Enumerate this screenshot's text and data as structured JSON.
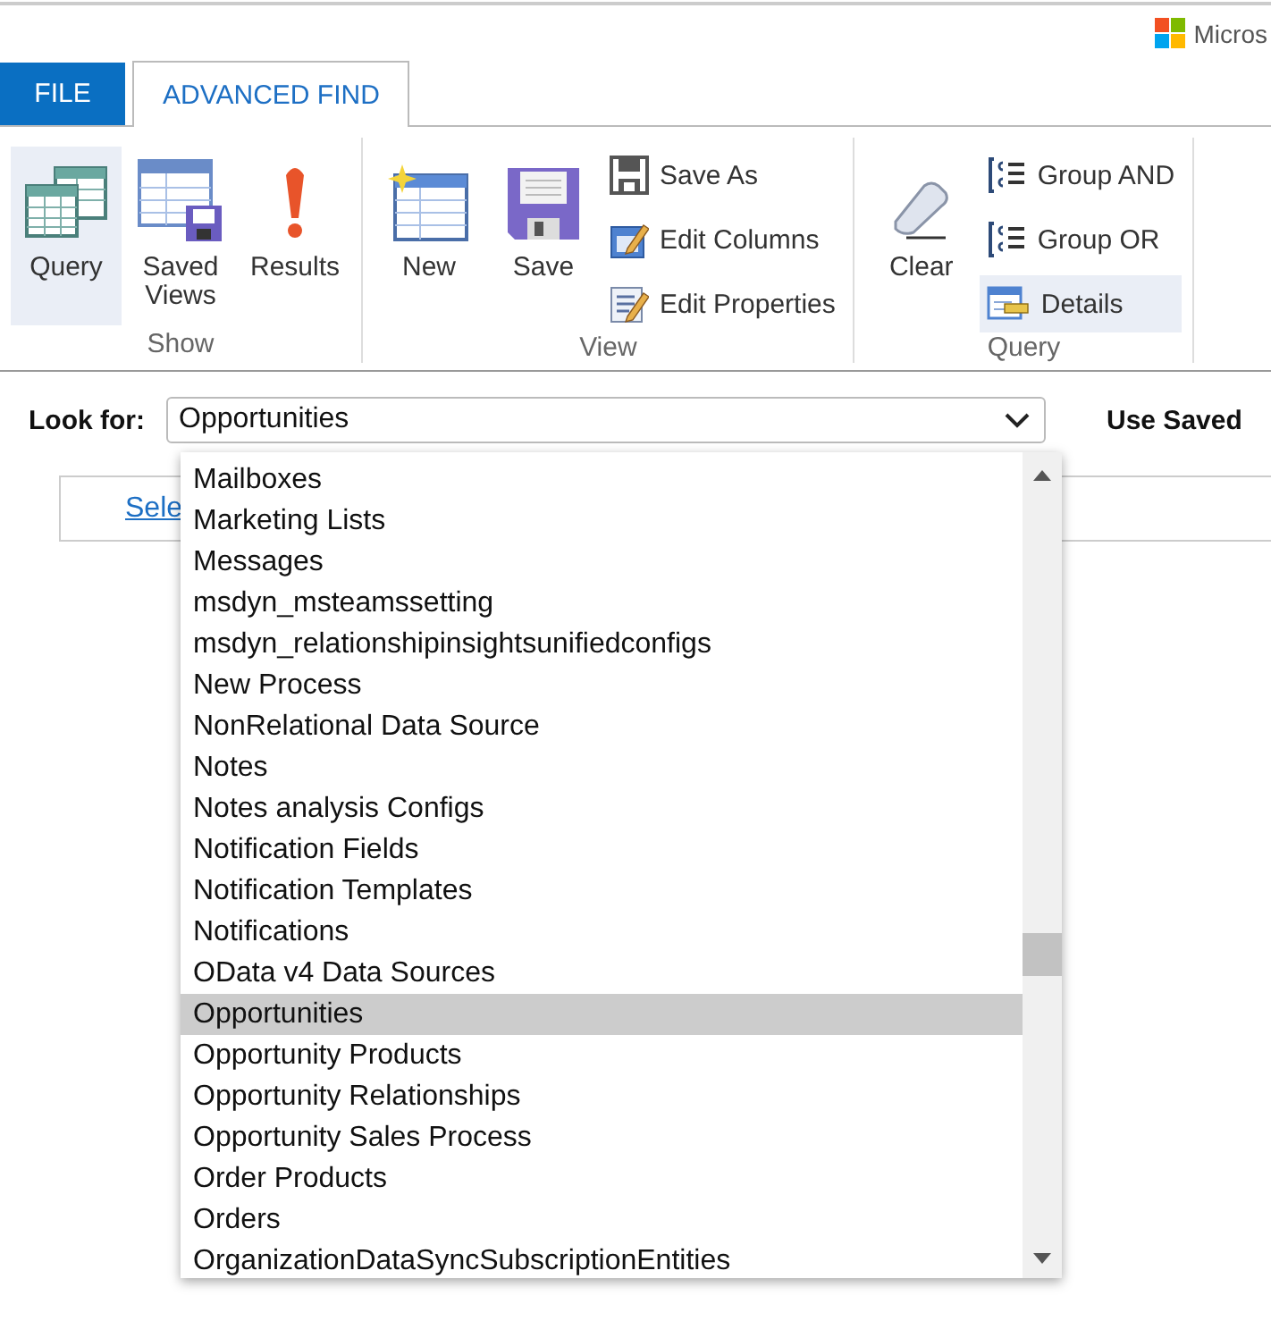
{
  "header": {
    "brand": "Micros"
  },
  "tabs": [
    {
      "label": "FILE",
      "kind": "file",
      "selected": false
    },
    {
      "label": "ADVANCED FIND",
      "kind": "tab",
      "selected": true
    }
  ],
  "ribbon": {
    "groups": [
      {
        "label": "Show",
        "buttons": [
          {
            "label": "Query",
            "kind": "large",
            "selected": true
          },
          {
            "label": "Saved Views",
            "kind": "large",
            "selected": false
          },
          {
            "label": "Results",
            "kind": "large",
            "selected": false
          }
        ]
      },
      {
        "label": "View",
        "buttons": [
          {
            "label": "New",
            "kind": "large",
            "selected": false
          },
          {
            "label": "Save",
            "kind": "large",
            "selected": false
          },
          {
            "label": "Save As",
            "kind": "small",
            "selected": false
          },
          {
            "label": "Edit Columns",
            "kind": "small",
            "selected": false
          },
          {
            "label": "Edit Properties",
            "kind": "small",
            "selected": false
          }
        ]
      },
      {
        "label": "Query",
        "buttons": [
          {
            "label": "Clear",
            "kind": "large",
            "selected": false
          },
          {
            "label": "Group AND",
            "kind": "small",
            "selected": false
          },
          {
            "label": "Group OR",
            "kind": "small",
            "selected": false
          },
          {
            "label": "Details",
            "kind": "small",
            "selected": true
          }
        ]
      }
    ]
  },
  "look_for": {
    "label": "Look for:",
    "value": "Opportunities",
    "use_saved": "Use Saved"
  },
  "query_panel": {
    "link": "Sele"
  },
  "dropdown": {
    "items": [
      {
        "label": "Mailboxes",
        "selected": false
      },
      {
        "label": "Marketing Lists",
        "selected": false
      },
      {
        "label": "Messages",
        "selected": false
      },
      {
        "label": "msdyn_msteamssetting",
        "selected": false
      },
      {
        "label": "msdyn_relationshipinsightsunifiedconfigs",
        "selected": false
      },
      {
        "label": "New Process",
        "selected": false
      },
      {
        "label": "NonRelational Data Source",
        "selected": false
      },
      {
        "label": "Notes",
        "selected": false
      },
      {
        "label": "Notes analysis Configs",
        "selected": false
      },
      {
        "label": "Notification Fields",
        "selected": false
      },
      {
        "label": "Notification Templates",
        "selected": false
      },
      {
        "label": "Notifications",
        "selected": false
      },
      {
        "label": "OData v4 Data Sources",
        "selected": false
      },
      {
        "label": "Opportunities",
        "selected": true
      },
      {
        "label": "Opportunity Products",
        "selected": false
      },
      {
        "label": "Opportunity Relationships",
        "selected": false
      },
      {
        "label": "Opportunity Sales Process",
        "selected": false
      },
      {
        "label": "Order Products",
        "selected": false
      },
      {
        "label": "Orders",
        "selected": false
      },
      {
        "label": "OrganizationDataSyncSubscriptionEntities",
        "selected": false
      }
    ]
  }
}
